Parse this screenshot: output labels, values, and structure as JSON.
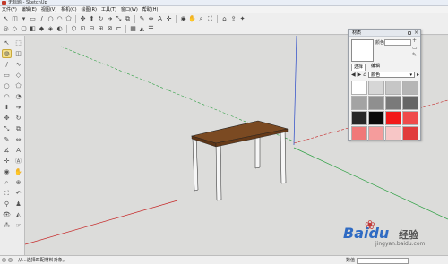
{
  "window": {
    "title": "无标题 - SketchUp"
  },
  "menu": [
    "文件(F)",
    "编辑(E)",
    "视图(V)",
    "相机(C)",
    "绘图(R)",
    "工具(T)",
    "窗口(W)",
    "帮助(H)"
  ],
  "colors": {
    "table_top": "#7b4a22",
    "table_legs": "#f6f6f6",
    "axis_red": "#c62828",
    "axis_green": "#2ea043",
    "axis_blue": "#2949c8",
    "ground": "#dcdcda"
  },
  "tray": {
    "title": "材质",
    "material_label": "颜色",
    "tabs": [
      "选择",
      "编辑"
    ],
    "collection": "颜色",
    "swatches": [
      "#ffffff",
      "#d6d6d6",
      "#c6c6c6",
      "#b5b5b5",
      "#a3a3a3",
      "#8f8f8f",
      "#7a7a7a",
      "#666666",
      "#272727",
      "#0a0a0a",
      "#f21a1a",
      "#ef4a4a",
      "#f07878",
      "#f59c9c",
      "#f7c6c6",
      "#e13b3b"
    ]
  },
  "status": {
    "message": "从...选择匹配材料对象。",
    "measurements_label": "数值"
  },
  "watermark": {
    "brand": "Baidu",
    "suffix": "经验",
    "url": "jingyan.baidu.com"
  }
}
